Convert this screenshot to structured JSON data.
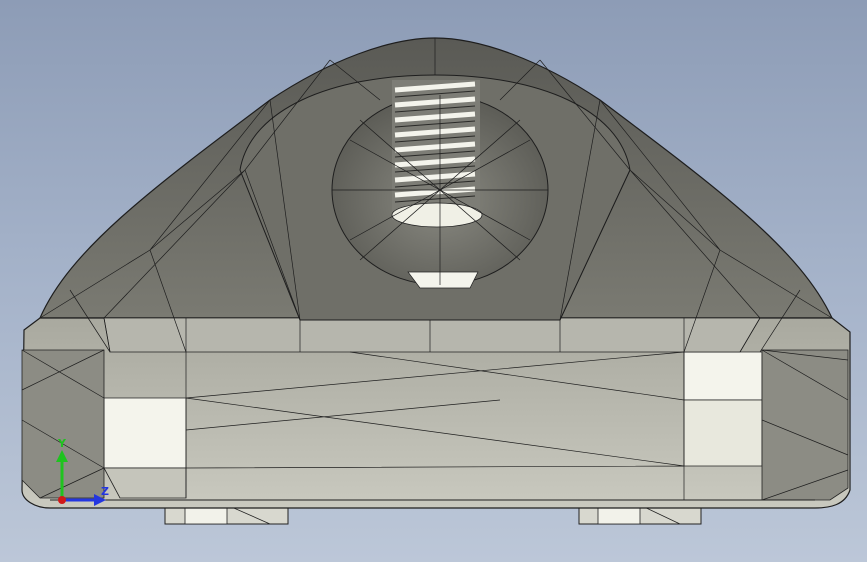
{
  "viewport": {
    "background_top": "#8d9cb6",
    "background_bottom": "#bcc7d8",
    "model": {
      "name": "meshed-part",
      "render_style": "shaded-with-edges",
      "face_color": "#9a9a90",
      "highlight_color": "#f2f2ea",
      "edge_color": "#1e1e1e"
    }
  },
  "triad": {
    "y_label": "Y",
    "z_label": "Z",
    "y_color": "#1fc31f",
    "z_color": "#2436e0",
    "x_color": "#d01818"
  }
}
